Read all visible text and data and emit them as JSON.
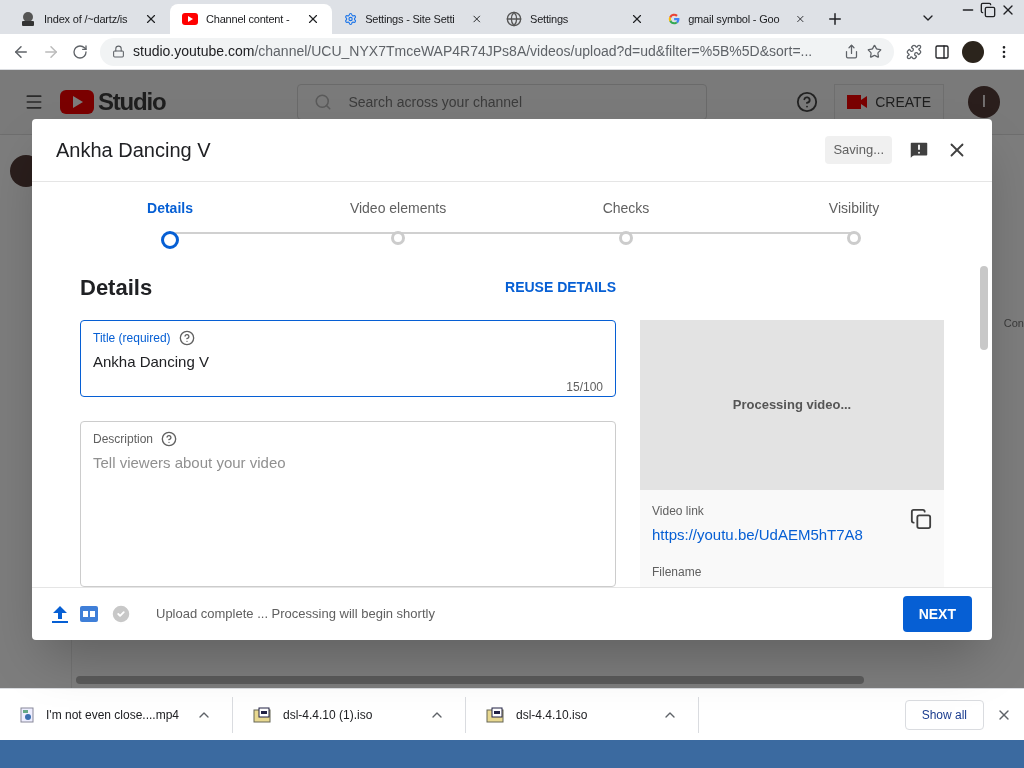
{
  "browser": {
    "tabs": [
      {
        "title": "Index of /~dartz/is",
        "kind": "site",
        "selected": false
      },
      {
        "title": "Channel content -",
        "kind": "youtube",
        "selected": true
      },
      {
        "title": "Settings - Site Setti",
        "kind": "settings",
        "selected": false
      },
      {
        "title": "Settings",
        "kind": "web",
        "selected": false
      },
      {
        "title": "gmail symbol - Goo",
        "kind": "search",
        "selected": false
      }
    ],
    "url_host": "studio.youtube.com",
    "url_path": "/channel/UCU_NYX7TmceWAP4R74JPs8A/videos/upload?d=ud&filter=%5B%5D&sort=..."
  },
  "studio": {
    "logo": "Studio",
    "search_placeholder": "Search across your channel",
    "create": "CREATE",
    "avatar": "I",
    "side_text": "Con"
  },
  "dialog": {
    "title": "Ankha Dancing V",
    "saving": "Saving...",
    "steps": [
      {
        "label": "Details",
        "selected": true
      },
      {
        "label": "Video elements",
        "selected": false
      },
      {
        "label": "Checks",
        "selected": false
      },
      {
        "label": "Visibility",
        "selected": false
      }
    ],
    "heading": "Details",
    "reuse": "REUSE DETAILS",
    "title_field": {
      "label": "Title (required)",
      "value": "Ankha Dancing V",
      "count": "15/100"
    },
    "description_field": {
      "label": "Description",
      "placeholder": "Tell viewers about your video"
    },
    "preview": "Processing video...",
    "video_link_label": "Video link",
    "video_link": "https://youtu.be/UdAEM5hT7A8",
    "filename_label": "Filename",
    "status": "Upload complete ... Processing will begin shortly",
    "next": "NEXT"
  },
  "downloads": {
    "items": [
      {
        "name": "I'm not even close....mp4",
        "kind": "video"
      },
      {
        "name": "dsl-4.4.10 (1).iso",
        "kind": "iso"
      },
      {
        "name": "dsl-4.4.10.iso",
        "kind": "iso"
      }
    ],
    "show_all": "Show all"
  }
}
